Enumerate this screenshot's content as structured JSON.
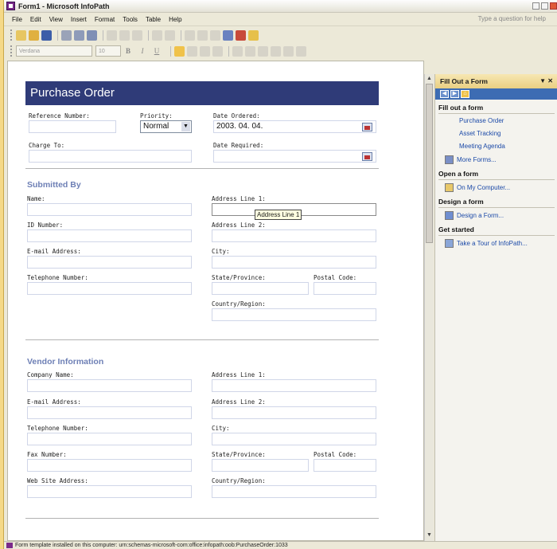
{
  "window": {
    "title": "Form1 - Microsoft InfoPath"
  },
  "menu": {
    "items": [
      "File",
      "Edit",
      "View",
      "Insert",
      "Format",
      "Tools",
      "Table",
      "Help"
    ],
    "ask_placeholder": "Type a question for help"
  },
  "format_toolbar": {
    "font": "Verdana",
    "size": "10",
    "bold": "B",
    "italic": "I",
    "underline": "U"
  },
  "form": {
    "title": "Purchase Order",
    "reference_label": "Reference Number:",
    "priority_label": "Priority:",
    "priority_value": "Normal",
    "date_ordered_label": "Date Ordered:",
    "date_ordered_value": "2003. 04. 04.",
    "charge_to_label": "Charge To:",
    "date_required_label": "Date Required:",
    "submitted": {
      "heading": "Submitted By",
      "name": "Name:",
      "id": "ID Number:",
      "email": "E-mail Address:",
      "phone": "Telephone Number:",
      "addr1": "Address Line 1:",
      "addr2": "Address Line 2:",
      "city": "City:",
      "state": "State/Province:",
      "postal": "Postal Code:",
      "country": "Country/Region:"
    },
    "tooltip": "Address Line 1",
    "vendor": {
      "heading": "Vendor Information",
      "company": "Company Name:",
      "email": "E-mail Address:",
      "phone": "Telephone Number:",
      "fax": "Fax Number:",
      "web": "Web Site Address:",
      "addr1": "Address Line 1:",
      "addr2": "Address Line 2:",
      "city": "City:",
      "state": "State/Province:",
      "postal": "Postal Code:",
      "country": "Country/Region:"
    }
  },
  "task_pane": {
    "title": "Fill Out a Form",
    "fill_heading": "Fill out a form",
    "fill_items": [
      "Purchase Order",
      "Asset Tracking",
      "Meeting Agenda"
    ],
    "more_forms": "More Forms...",
    "open_heading": "Open a form",
    "open_item": "On My Computer...",
    "design_heading": "Design a form",
    "design_item": "Design a Form...",
    "start_heading": "Get started",
    "start_item": "Take a Tour of InfoPath..."
  },
  "status": "Form template installed on this computer: urn:schemas-microsoft-com:office:infopath:oob:PurchaseOrder:1033",
  "colors": {
    "banner": "#2f3b78",
    "section": "#6d7fb5",
    "taskpane_header": "#e9cf82"
  }
}
